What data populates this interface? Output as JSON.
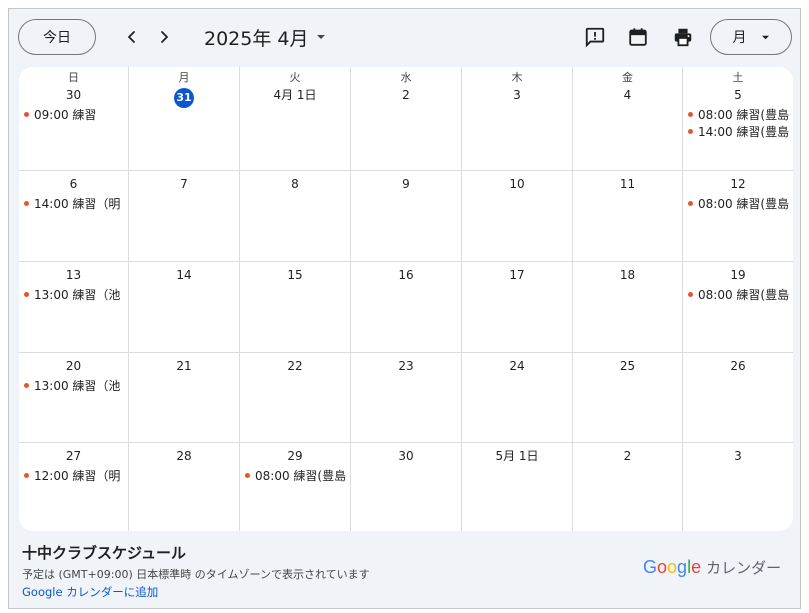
{
  "toolbar": {
    "today_label": "今日",
    "month_title": "2025年 4月",
    "view_label": "月"
  },
  "colors": {
    "background": "#f0f4f9",
    "today_accent": "#0b57d0",
    "event_dot": "#e4572e"
  },
  "weekdays": [
    "日",
    "月",
    "火",
    "水",
    "木",
    "金",
    "土"
  ],
  "weeks": [
    [
      {
        "day": "30",
        "events": [
          "09:00 練習"
        ]
      },
      {
        "day": "31",
        "today": true,
        "events": []
      },
      {
        "day": "4月 1日",
        "events": []
      },
      {
        "day": "2",
        "events": []
      },
      {
        "day": "3",
        "events": []
      },
      {
        "day": "4",
        "events": []
      },
      {
        "day": "5",
        "events": [
          "08:00 練習(豊島",
          "14:00 練習(豊島"
        ]
      }
    ],
    [
      {
        "day": "6",
        "events": [
          "14:00 練習（明"
        ]
      },
      {
        "day": "7",
        "events": []
      },
      {
        "day": "8",
        "events": []
      },
      {
        "day": "9",
        "events": []
      },
      {
        "day": "10",
        "events": []
      },
      {
        "day": "11",
        "events": []
      },
      {
        "day": "12",
        "events": [
          "08:00 練習(豊島"
        ]
      }
    ],
    [
      {
        "day": "13",
        "events": [
          "13:00 練習（池"
        ]
      },
      {
        "day": "14",
        "events": []
      },
      {
        "day": "15",
        "events": []
      },
      {
        "day": "16",
        "events": []
      },
      {
        "day": "17",
        "events": []
      },
      {
        "day": "18",
        "events": []
      },
      {
        "day": "19",
        "events": [
          "08:00 練習(豊島"
        ]
      }
    ],
    [
      {
        "day": "20",
        "events": [
          "13:00 練習（池"
        ]
      },
      {
        "day": "21",
        "events": []
      },
      {
        "day": "22",
        "events": []
      },
      {
        "day": "23",
        "events": []
      },
      {
        "day": "24",
        "events": []
      },
      {
        "day": "25",
        "events": []
      },
      {
        "day": "26",
        "events": []
      }
    ],
    [
      {
        "day": "27",
        "events": [
          "12:00 練習（明"
        ]
      },
      {
        "day": "28",
        "events": []
      },
      {
        "day": "29",
        "events": [
          "08:00 練習(豊島"
        ]
      },
      {
        "day": "30",
        "events": []
      },
      {
        "day": "5月 1日",
        "events": []
      },
      {
        "day": "2",
        "events": []
      },
      {
        "day": "3",
        "events": []
      }
    ]
  ],
  "footer": {
    "calendar_name": "十中クラブスケジュール",
    "timezone_note": "予定は (GMT+09:00) 日本標準時 のタイムゾーンで表示されています",
    "add_link": "Google カレンダーに追加",
    "brand_google": "Google",
    "brand_label": "カレンダー"
  },
  "icons": {
    "prev": "chevron-left-icon",
    "next": "chevron-right-icon",
    "month_dropdown": "caret-down-icon",
    "feedback": "feedback-icon",
    "calendar": "calendar-icon",
    "print": "print-icon"
  }
}
